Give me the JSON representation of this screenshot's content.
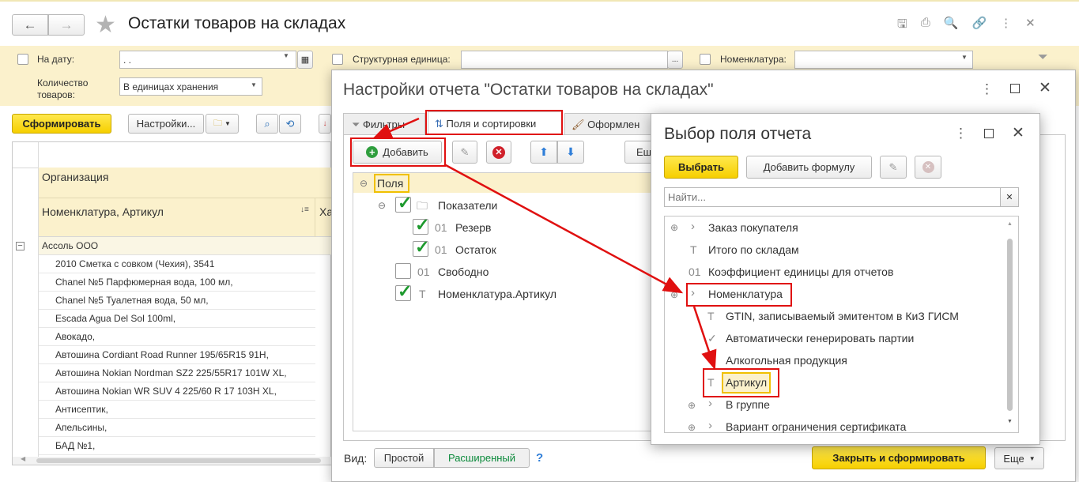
{
  "main": {
    "title": "Остатки товаров на складах",
    "filters": {
      "date_label": "На дату:",
      "date_value": " .  .",
      "unit_label": "Структурная единица:",
      "nomen_label": "Номенклатура:",
      "qty_label": "Количество товаров:",
      "qty_value": "В единицах хранения"
    },
    "toolbar": {
      "generate": "Сформировать",
      "settings": "Настройки..."
    },
    "table": {
      "col1": "Организация",
      "col2": "Номенклатура, Артикул",
      "col3": "Ха",
      "group": "Ассоль ООО",
      "rows": [
        "2010 Сметка с совком (Чехия), 3541",
        "Chanel №5 Парфюмерная вода, 100 мл,",
        "Chanel №5 Туалетная вода, 50 мл,",
        "Escada Agua Del Sol 100ml,",
        "Авокадо,",
        "Автошина Cordiant Road Runner 195/65R15 91H,",
        "Автошина Nokian Nordman SZ2 225/55R17 101W XL,",
        "Автошина Nokian WR SUV 4 225/60 R 17 103H XL,",
        "Антисептик,",
        "Апельсины,",
        "БАД №1,"
      ]
    }
  },
  "settings": {
    "title": "Настройки отчета \"Остатки товаров на складах\"",
    "tabs": [
      "Фильтры",
      "Поля и сортировки",
      "Оформлен"
    ],
    "add": "Добавить",
    "more": "Ещ",
    "tree": {
      "root": "Поля",
      "indicators": "Показатели",
      "reserve": "Резерв",
      "stock": "Остаток",
      "free": "Свободно",
      "article": "Номенклатура.Артикул",
      "num_icon": "01",
      "text_icon": "T"
    },
    "view_label": "Вид:",
    "view_simple": "Простой",
    "view_extended": "Расширенный",
    "help": "?",
    "close_generate": "Закрыть и сформировать",
    "more_btn": "Еще"
  },
  "picker": {
    "title": "Выбор поля отчета",
    "select": "Выбрать",
    "add_formula": "Добавить формулу",
    "search_placeholder": "Найти...",
    "items": [
      "Заказ покупателя",
      "Итого по складам",
      "Коэффициент единицы для отчетов",
      "Номенклатура",
      "GTIN, записываемый эмитентом в КиЗ ГИСМ",
      "Автоматически генерировать партии",
      "Алкогольная продукция",
      "Артикул",
      "В группе",
      "Вариант ограничения сертификата"
    ]
  },
  "colors": {
    "accent_yellow": "#f6cf00",
    "highlight": "#fbf1cc",
    "marker_red": "#e01010",
    "check_green": "#1e9a2e",
    "link_green": "#0a8a3a"
  }
}
